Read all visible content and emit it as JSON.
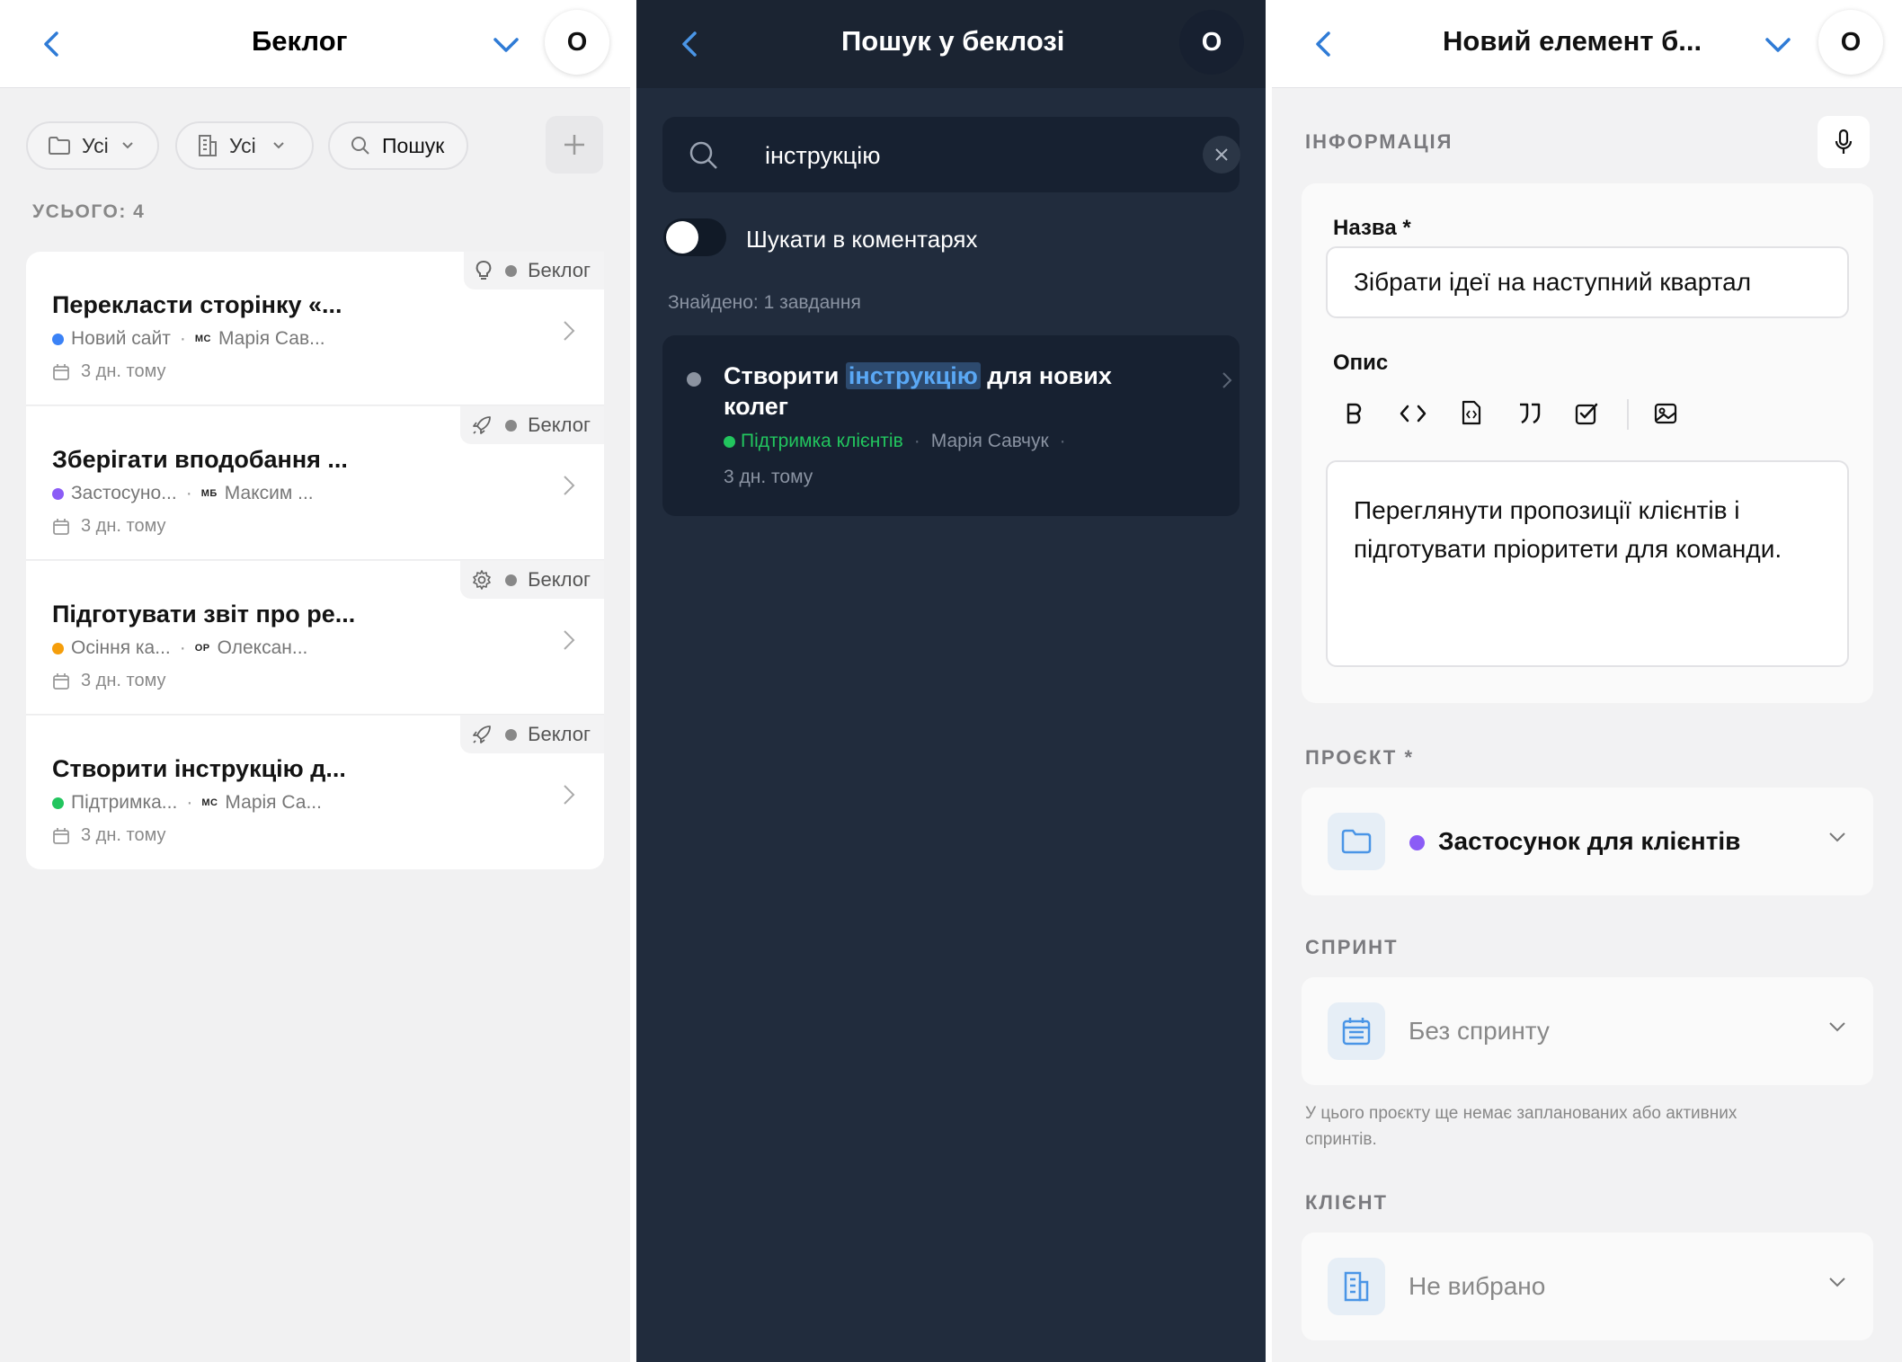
{
  "backlog": {
    "title": "Беклог",
    "avatar": "О",
    "filters": [
      {
        "label": "Усі",
        "icon": "folder-icon"
      },
      {
        "label": "Усі",
        "icon": "building-icon"
      },
      {
        "label": "Пошук",
        "icon": "search-icon"
      }
    ],
    "count": "УСЬОГО: 4",
    "items": [
      {
        "title": "Перекласти сторінку «...",
        "project": "Новий сайт",
        "project_color": "#3b82f6",
        "initials": "МС",
        "assignee": "Марія Сав...",
        "date": "3 дн. тому",
        "tag": "Беклог",
        "icon": "lightbulb-icon"
      },
      {
        "title": "Зберігати вподобання ...",
        "project": "Застосуно...",
        "project_color": "#8b5cf6",
        "initials": "МБ",
        "assignee": "Максим ...",
        "date": "3 дн. тому",
        "tag": "Беклог",
        "icon": "rocket-icon"
      },
      {
        "title": "Підготувати звіт про ре...",
        "project": "Осіння ка...",
        "project_color": "#f59e0b",
        "initials": "ОР",
        "assignee": "Олексан...",
        "date": "3 дн. тому",
        "tag": "Беклог",
        "icon": "gear-icon"
      },
      {
        "title": "Створити інструкцію д...",
        "project": "Підтримка...",
        "project_color": "#22c55e",
        "initials": "МС",
        "assignee": "Марія Са...",
        "date": "3 дн. тому",
        "tag": "Беклог",
        "icon": "rocket-icon"
      }
    ]
  },
  "search": {
    "title": "Пошук у беклозі",
    "avatar": "О",
    "query": "інструкцію",
    "toggle_label": "Шукати в коментарях",
    "found": "Знайдено: 1 завдання",
    "result": {
      "title_before": "Створити",
      "highlight": "інструкцію",
      "title_after": "для нових",
      "title_line2": "колег",
      "project": "Підтримка клієнтів",
      "assignee": "Марія Савчук",
      "date": "3 дн. тому"
    }
  },
  "new_item": {
    "title": "Новий елемент б...",
    "avatar": "О",
    "info_label": "ІНФОРМАЦІЯ",
    "name_label": "Назва *",
    "name_value": "Зібрати ідеї на наступний квартал",
    "desc_label": "Опис",
    "desc_line1": "Переглянути пропозиції клієнтів і",
    "desc_line2": "підготувати пріоритети для команди.",
    "project_label": "ПРОЄКТ *",
    "project_value": "Застосунок для клієнтів",
    "project_color": "#8b5cf6",
    "sprint_label": "СПРИНТ",
    "sprint_value": "Без спринту",
    "sprint_hint_1": "У цього проєкту ще немає запланованих або активних",
    "sprint_hint_2": "спринтів.",
    "client_label": "КЛІЄНТ",
    "client_value": "Не вибрано"
  },
  "colors": {
    "accent": "#2f7bd6",
    "dark_bg": "#212c3d",
    "highlight_bg": "#2d4a6e",
    "highlight_text": "#5aa8f5",
    "green": "#22c55e"
  }
}
